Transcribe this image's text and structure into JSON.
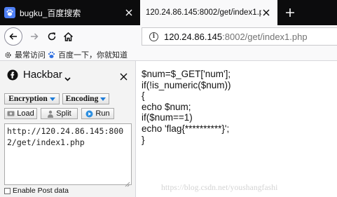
{
  "tabs": [
    {
      "title": "bugku_百度搜索",
      "active": false
    },
    {
      "title": "120.24.86.145:8002/get/index1.p",
      "active": true
    }
  ],
  "url": {
    "host": "120.24.86.145",
    "path": ":8002/get/index1.php"
  },
  "bookmarks": [
    {
      "label": "最常访问",
      "icon": "gear-icon"
    },
    {
      "label": "百度一下，你就知道",
      "icon": "baidu-paw-icon"
    }
  ],
  "hackbar": {
    "title": "Hackbar",
    "buttons": {
      "encryption": "Encryption",
      "encoding": "Encoding",
      "load": "Load",
      "split": "Split",
      "run": "Run"
    },
    "textarea_value": "http://120.24.86.145:8002/get/index1.php",
    "post_label": "Enable Post data"
  },
  "page": {
    "code": "$num=$_GET['num'];\nif(!is_numeric($num))\n{\necho $num;\nif($num==1)\necho 'flag{**********}';\n}"
  },
  "watermark": "https://blog.csdn.net/youshangfashi",
  "colors": {
    "tabstrip": "#0c0c0d",
    "active_tab": "#f9f9fa",
    "accent_blue": "#1d7bd8",
    "favicon_blue": "#4e7ff4"
  }
}
